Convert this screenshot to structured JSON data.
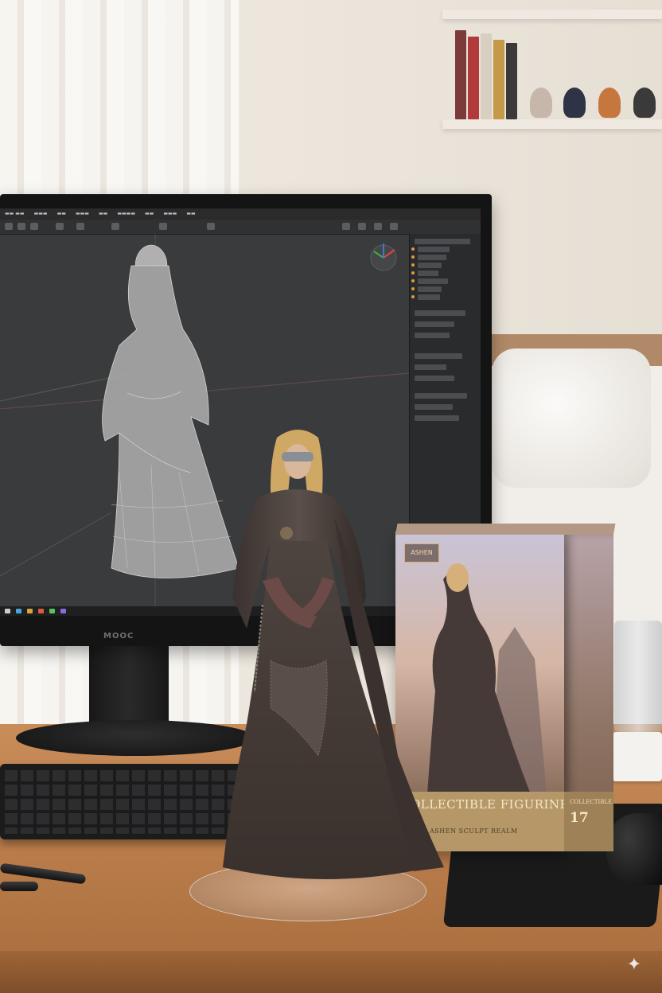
{
  "monitor": {
    "brand": "MOOC"
  },
  "box": {
    "logo": "ASHEN",
    "title": "COLLECTIBLE FIGURINE",
    "subtitle": "ASHEN SCULPT REALM",
    "side_label": "COLLECTIBLE FIGURINE",
    "side_number": "17"
  },
  "colors": {
    "desk": "#b87b49",
    "screen": "#3a3b3d",
    "box_band": "#b69868",
    "figurine_cloak": "#4a403c"
  },
  "icons": {
    "sparkle": "✦"
  }
}
